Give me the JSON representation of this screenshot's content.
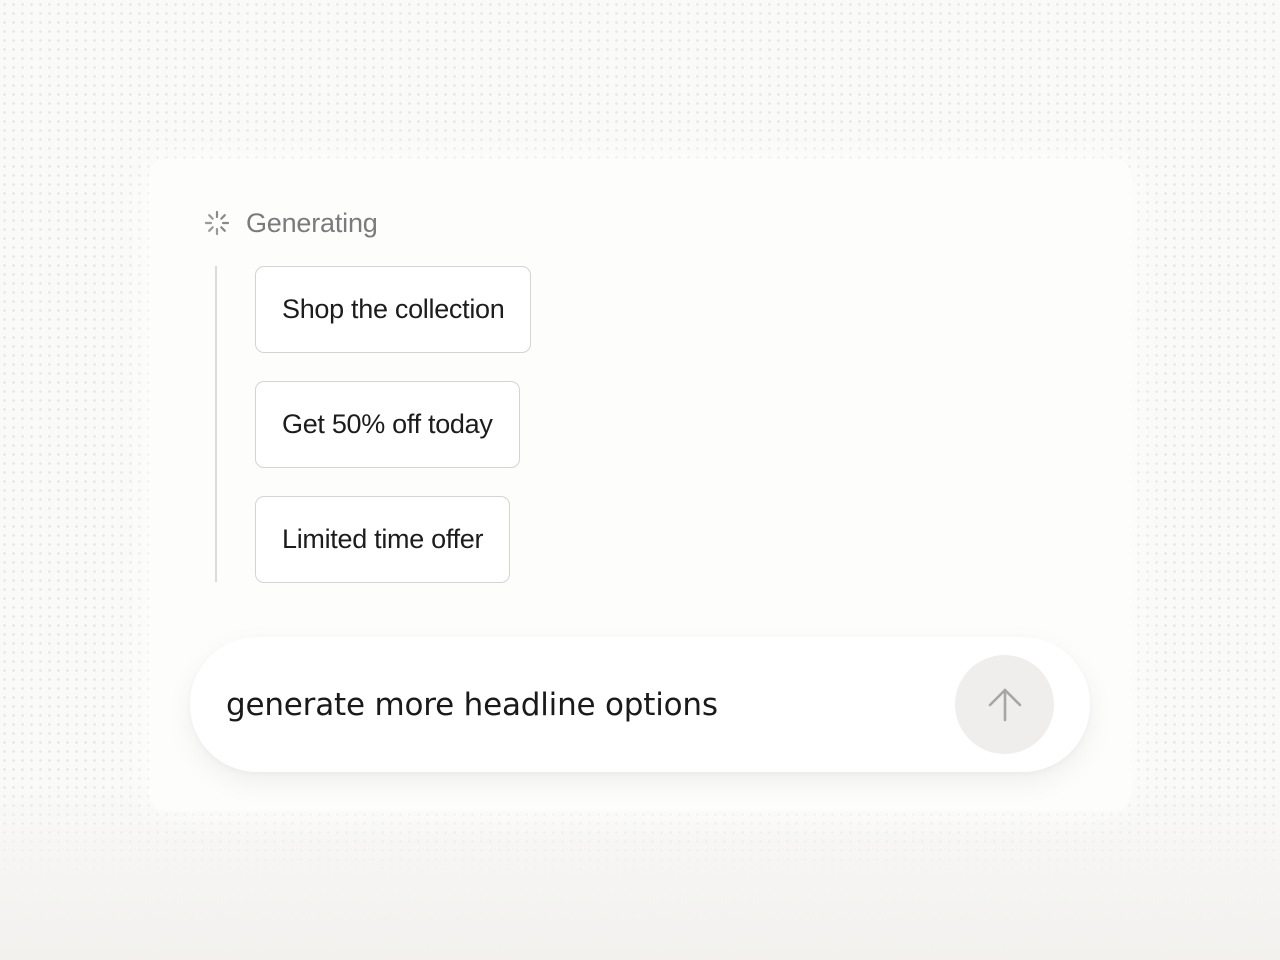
{
  "status": {
    "label": "Generating",
    "icon": "spinner-icon"
  },
  "options": [
    {
      "label": "Shop the collection"
    },
    {
      "label": "Get 50% off today"
    },
    {
      "label": "Limited time offer"
    }
  ],
  "composer": {
    "value": "generate more headline options",
    "send_icon": "arrow-up-icon"
  },
  "colors": {
    "status_text": "#7b7b7b",
    "chip_border": "#d4d4d4",
    "send_button_bg": "#efeeec",
    "send_icon": "#a6a6a6"
  }
}
